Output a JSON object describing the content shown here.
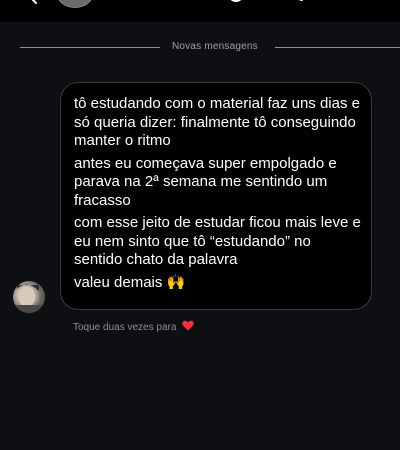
{
  "header": {
    "back_icon": "chevron-left-icon",
    "icons": [
      "phone-icon",
      "video-icon",
      "info-icon"
    ]
  },
  "divider": {
    "label": "Novas mensagens"
  },
  "message": {
    "lines": [
      "tô estudando com o material faz uns dias e só queria dizer: finalmente tô conseguindo manter o ritmo",
      "antes eu começava super empolgado e parava na 2ª semana me sentindo um fracasso",
      "com esse jeito de estudar ficou mais leve e eu nem sinto que tô “estudando” no sentido chato da palavra",
      "valeu demais 🙌"
    ]
  },
  "reaction_hint": {
    "text": "Toque duas vezes para",
    "icon": "heart-icon"
  },
  "colors": {
    "background": "#0d0f13",
    "bubble": "#000000",
    "bubble_border": "#3a3a3f",
    "heart": "#ff3040"
  }
}
